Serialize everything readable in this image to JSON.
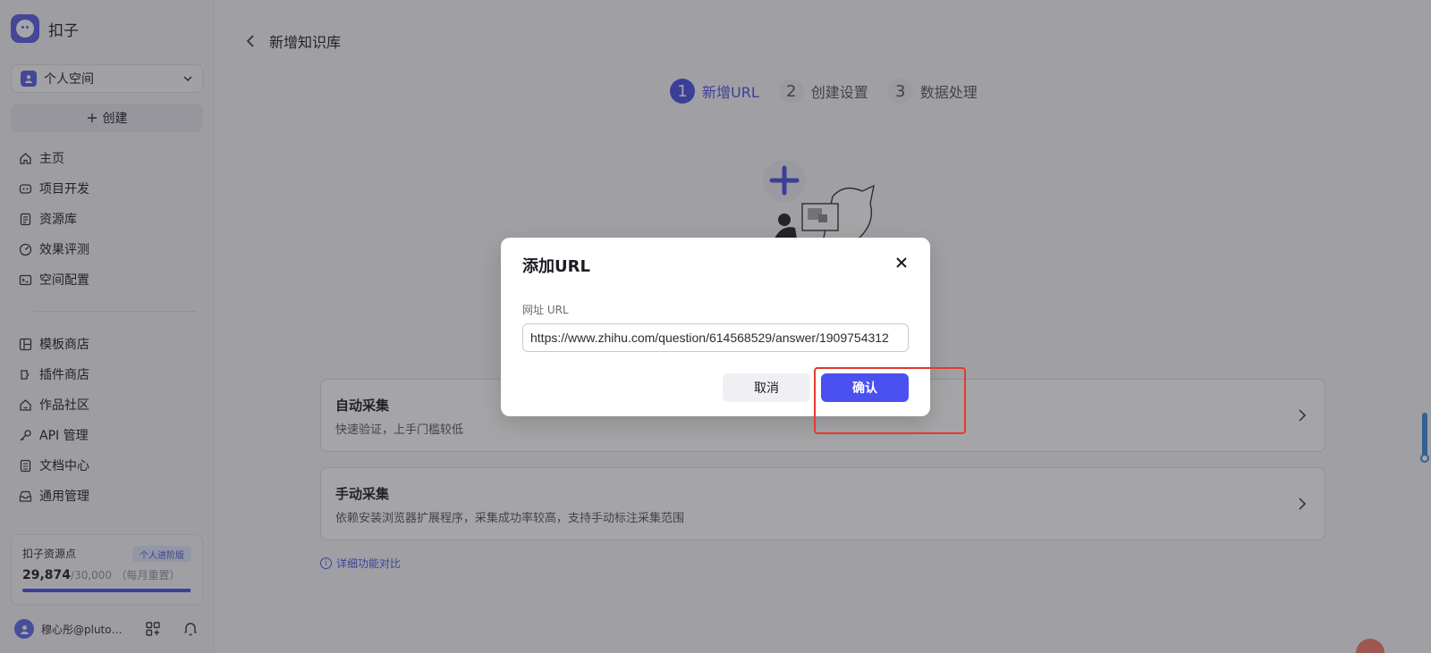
{
  "app": {
    "name": "扣子"
  },
  "sidebar": {
    "space_label": "个人空间",
    "create_label": "创建",
    "nav_primary": [
      {
        "label": "主页",
        "icon": "home-icon"
      },
      {
        "label": "项目开发",
        "icon": "robot-icon"
      },
      {
        "label": "资源库",
        "icon": "library-icon"
      },
      {
        "label": "效果评测",
        "icon": "gauge-icon"
      },
      {
        "label": "空间配置",
        "icon": "terminal-icon"
      }
    ],
    "nav_secondary": [
      {
        "label": "模板商店",
        "icon": "template-icon"
      },
      {
        "label": "插件商店",
        "icon": "plugin-icon"
      },
      {
        "label": "作品社区",
        "icon": "community-icon"
      },
      {
        "label": "API 管理",
        "icon": "key-icon"
      },
      {
        "label": "文档中心",
        "icon": "document-icon"
      },
      {
        "label": "通用管理",
        "icon": "inbox-icon"
      }
    ],
    "points": {
      "title": "扣子资源点",
      "badge": "个人进阶版",
      "used": "29,874",
      "total": "/30,000",
      "note": "（每月重置）",
      "fraction": 0.9958
    },
    "user": {
      "name": "穆心彤@pluto…"
    }
  },
  "main": {
    "page_title": "新增知识库",
    "steps": [
      {
        "num": "1",
        "label": "新增URL",
        "active": true
      },
      {
        "num": "2",
        "label": "创建设置",
        "active": false
      },
      {
        "num": "3",
        "label": "数据处理",
        "active": false
      }
    ],
    "options": [
      {
        "title": "自动采集",
        "desc": "快速验证，上手门槛较低"
      },
      {
        "title": "手动采集",
        "desc": "依赖安装浏览器扩展程序，采集成功率较高，支持手动标注采集范围"
      }
    ],
    "compare_link": "详细功能对比"
  },
  "dialog": {
    "title": "添加URL",
    "field_label": "网址 URL",
    "url_value": "https://www.zhihu.com/question/614568529/answer/1909754312",
    "cancel_label": "取消",
    "confirm_label": "确认"
  },
  "colors": {
    "accent": "#4b50e6",
    "highlight": "#e33a2c"
  }
}
